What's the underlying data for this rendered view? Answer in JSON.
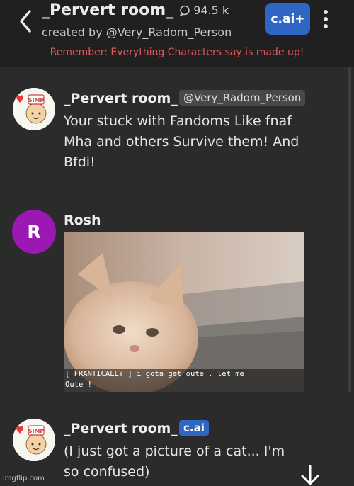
{
  "header": {
    "title": "_Pervert room_",
    "chat_count": "94.5 k",
    "creator": "created by @Very_Radom_Person",
    "cai_plus_label": "c.ai+",
    "disclaimer": "Remember: Everything Characters say is made up!"
  },
  "messages": [
    {
      "author": "_Pervert room_",
      "tag": "@Very_Radom_Person",
      "text": "Your stuck with Fandoms Like fnaf\nMha and others Survive them! And\nBfdi!"
    },
    {
      "author": "Rosh",
      "avatar_letter": "R",
      "image_caption": "[ FRANTICALLY ] i gota get oute .  let me\nOute !"
    },
    {
      "author": "_Pervert room_",
      "tag": "c.ai",
      "text": "(I just got a picture of a cat... I'm\nso confused)"
    }
  ],
  "footer": {
    "watermark": "imgflip.com"
  },
  "colors": {
    "accent": "#2f66c4",
    "disclaimer": "#e0585a",
    "avatar_r": "#9b18b4"
  },
  "icons": [
    "back-arrow-icon",
    "chat-bubble-icon",
    "more-vertical-icon",
    "arrow-down-icon"
  ]
}
